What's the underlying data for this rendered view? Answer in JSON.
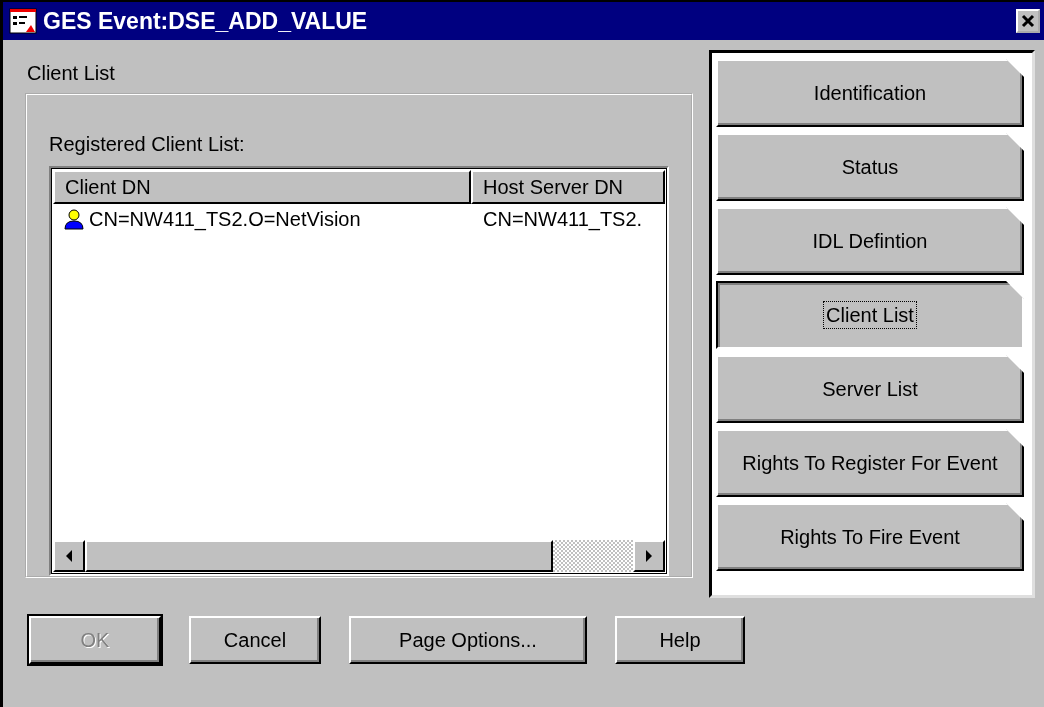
{
  "window": {
    "title": "GES Event:DSE_ADD_VALUE"
  },
  "page": {
    "title": "Client List",
    "group_label": "Registered Client List:",
    "table": {
      "columns": [
        "Client DN",
        "Host Server DN"
      ],
      "rows": [
        {
          "cells": [
            "CN=NW411_TS2.O=NetVision",
            "CN=NW411_TS2."
          ]
        }
      ]
    }
  },
  "tabs": [
    {
      "label": "Identification",
      "selected": false
    },
    {
      "label": "Status",
      "selected": false
    },
    {
      "label": "IDL Defintion",
      "selected": false
    },
    {
      "label": "Client List",
      "selected": true
    },
    {
      "label": "Server List",
      "selected": false
    },
    {
      "label": "Rights To Register For Event",
      "selected": false
    },
    {
      "label": "Rights To Fire Event",
      "selected": false
    }
  ],
  "buttons": [
    {
      "label": "OK",
      "disabled": true
    },
    {
      "label": "Cancel",
      "disabled": false
    },
    {
      "label": "Page Options...",
      "disabled": false
    },
    {
      "label": "Help",
      "disabled": false
    }
  ]
}
